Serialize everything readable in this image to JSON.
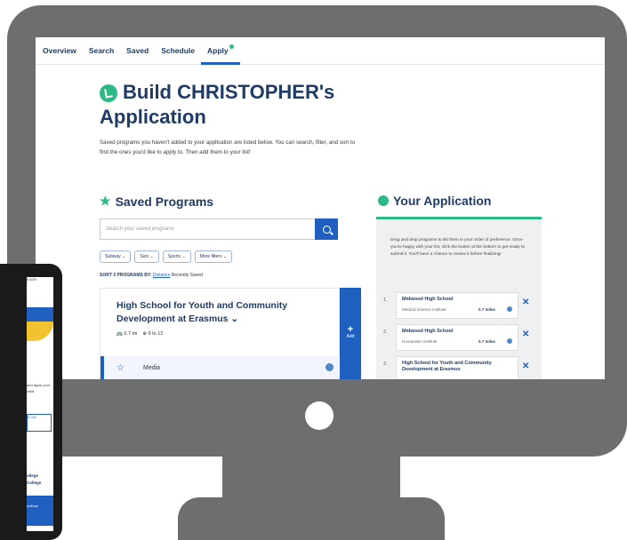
{
  "nav": {
    "tabs": [
      "Overview",
      "Search",
      "Saved",
      "Schedule",
      "Apply"
    ]
  },
  "page": {
    "title": "Build CHRISTOPHER's Application",
    "intro": "Saved programs you haven't added to your application are listed below. You can search, filter, and sort to find the ones you'd like to apply to. Then add them to your list!"
  },
  "saved": {
    "heading": "Saved Programs",
    "search_placeholder": "Search your saved programs",
    "filters": [
      "Subway ⌄",
      "Size ⌄",
      "Sports ⌄",
      "More filters ⌄"
    ],
    "sort_label": "SORT 3 PROGRAMS BY:",
    "sort_active": "Distance",
    "sort_other": "Recently Saved",
    "card": {
      "title": "High School for Youth and Community Development at Erasmus ⌄",
      "distance": "0.7 mi",
      "grades": "9 to 12",
      "program": "Media",
      "add_label": "Add"
    }
  },
  "application": {
    "heading": "Your Application",
    "instructions": "Drag and drop programs to list them in your order of preference. Once you're happy with your list, click the button at the bottom to get ready to submit it. You'll have a chance to review it before finalizing!",
    "items": [
      {
        "num": "1.",
        "name": "Midwood High School",
        "program": "Medical Science Institute",
        "distance": "0.7 miles"
      },
      {
        "num": "2.",
        "name": "Midwood High School",
        "program": "Humanities Institute",
        "distance": "0.7 miles"
      },
      {
        "num": "3.",
        "name": "High School for Youth and Community Development at Erasmus",
        "program": "",
        "distance": ""
      }
    ]
  },
  "phone": {
    "status": "8 83%",
    "text": "and apply your child",
    "button": "e List",
    "college": "ollege College",
    "bottom": "ontinue"
  },
  "colors": {
    "primary": "#1f5fbf",
    "accent": "#2eb886",
    "title": "#1f3b66",
    "frame": "#6e6e6e"
  }
}
